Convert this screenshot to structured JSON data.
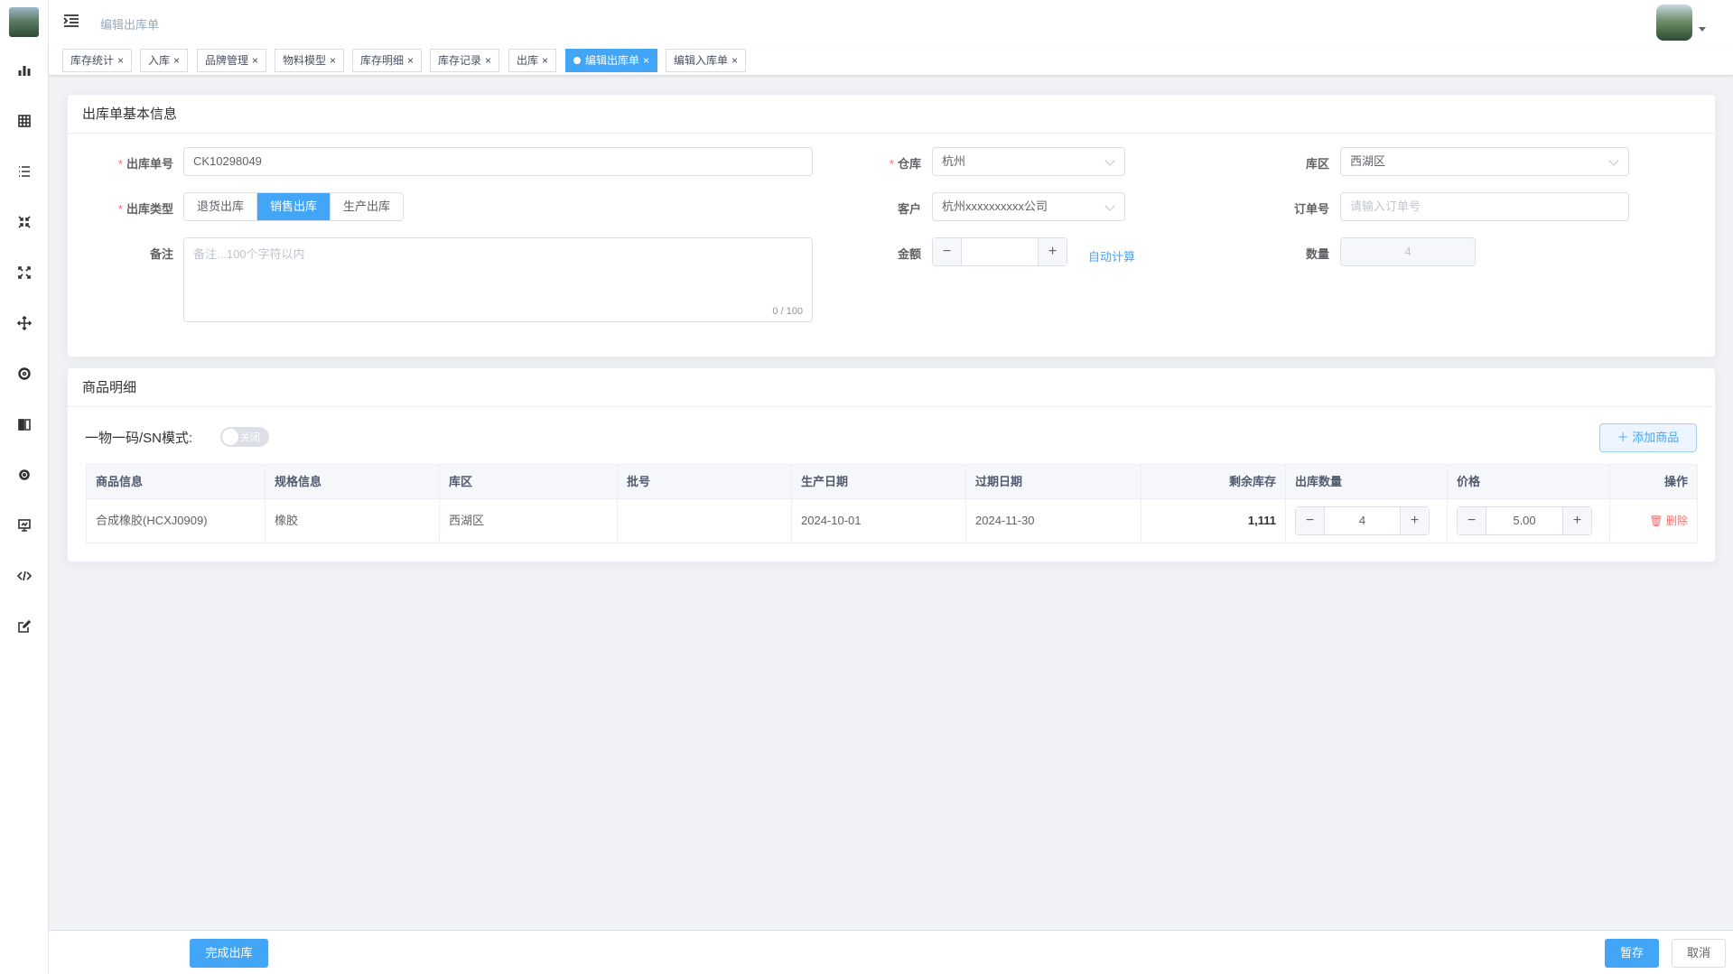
{
  "header": {
    "breadcrumb": "编辑出库单"
  },
  "tags": [
    {
      "label": "库存统计",
      "active": false
    },
    {
      "label": "入库",
      "active": false
    },
    {
      "label": "品牌管理",
      "active": false
    },
    {
      "label": "物料模型",
      "active": false
    },
    {
      "label": "库存明细",
      "active": false
    },
    {
      "label": "库存记录",
      "active": false
    },
    {
      "label": "出库",
      "active": false
    },
    {
      "label": "编辑出库单",
      "active": true
    },
    {
      "label": "编辑入库单",
      "active": false
    }
  ],
  "sidebar": {
    "icons": [
      "bar-chart-icon",
      "table-icon",
      "list-icon",
      "shrink-icon",
      "expand-icon",
      "move-icon",
      "circle-icon",
      "book-icon",
      "gear-icon",
      "monitor-icon",
      "code-icon",
      "edit-icon"
    ]
  },
  "basic": {
    "title": "出库单基本信息",
    "order_no_label": "出库单号",
    "order_no_value": "CK10298049",
    "type_label": "出库类型",
    "types": [
      "退货出库",
      "销售出库",
      "生产出库"
    ],
    "selected_type": "销售出库",
    "remark_label": "备注",
    "remark_placeholder": "备注...100个字符以内",
    "remark_counter": "0 / 100",
    "warehouse_label": "仓库",
    "warehouse_value": "杭州",
    "customer_label": "客户",
    "customer_value": "杭州xxxxxxxxxx公司",
    "amount_label": "金额",
    "amount_value": "",
    "auto_calc": "自动计算",
    "zone_label": "库区",
    "zone_value": "西湖区",
    "order_num_label": "订单号",
    "order_num_placeholder": "请输入订单号",
    "qty_label": "数量",
    "qty_value": "4"
  },
  "detail": {
    "title": "商品明细",
    "sn_label": "一物一码/SN模式:",
    "sn_switch": "关闭",
    "add_button": "添加商品",
    "columns": [
      "商品信息",
      "规格信息",
      "库区",
      "批号",
      "生产日期",
      "过期日期",
      "剩余库存",
      "出库数量",
      "价格",
      "操作"
    ],
    "rows": [
      {
        "product": "合成橡胶(HCXJ0909)",
        "spec": "橡胶",
        "zone": "西湖区",
        "batch": "",
        "mfg_date": "2024-10-01",
        "exp_date": "2024-11-30",
        "stock": "1,111",
        "qty": "4",
        "price": "5.00",
        "action": "删除"
      }
    ]
  },
  "footer": {
    "complete": "完成出库",
    "save_draft": "暂存",
    "cancel": "取消"
  }
}
